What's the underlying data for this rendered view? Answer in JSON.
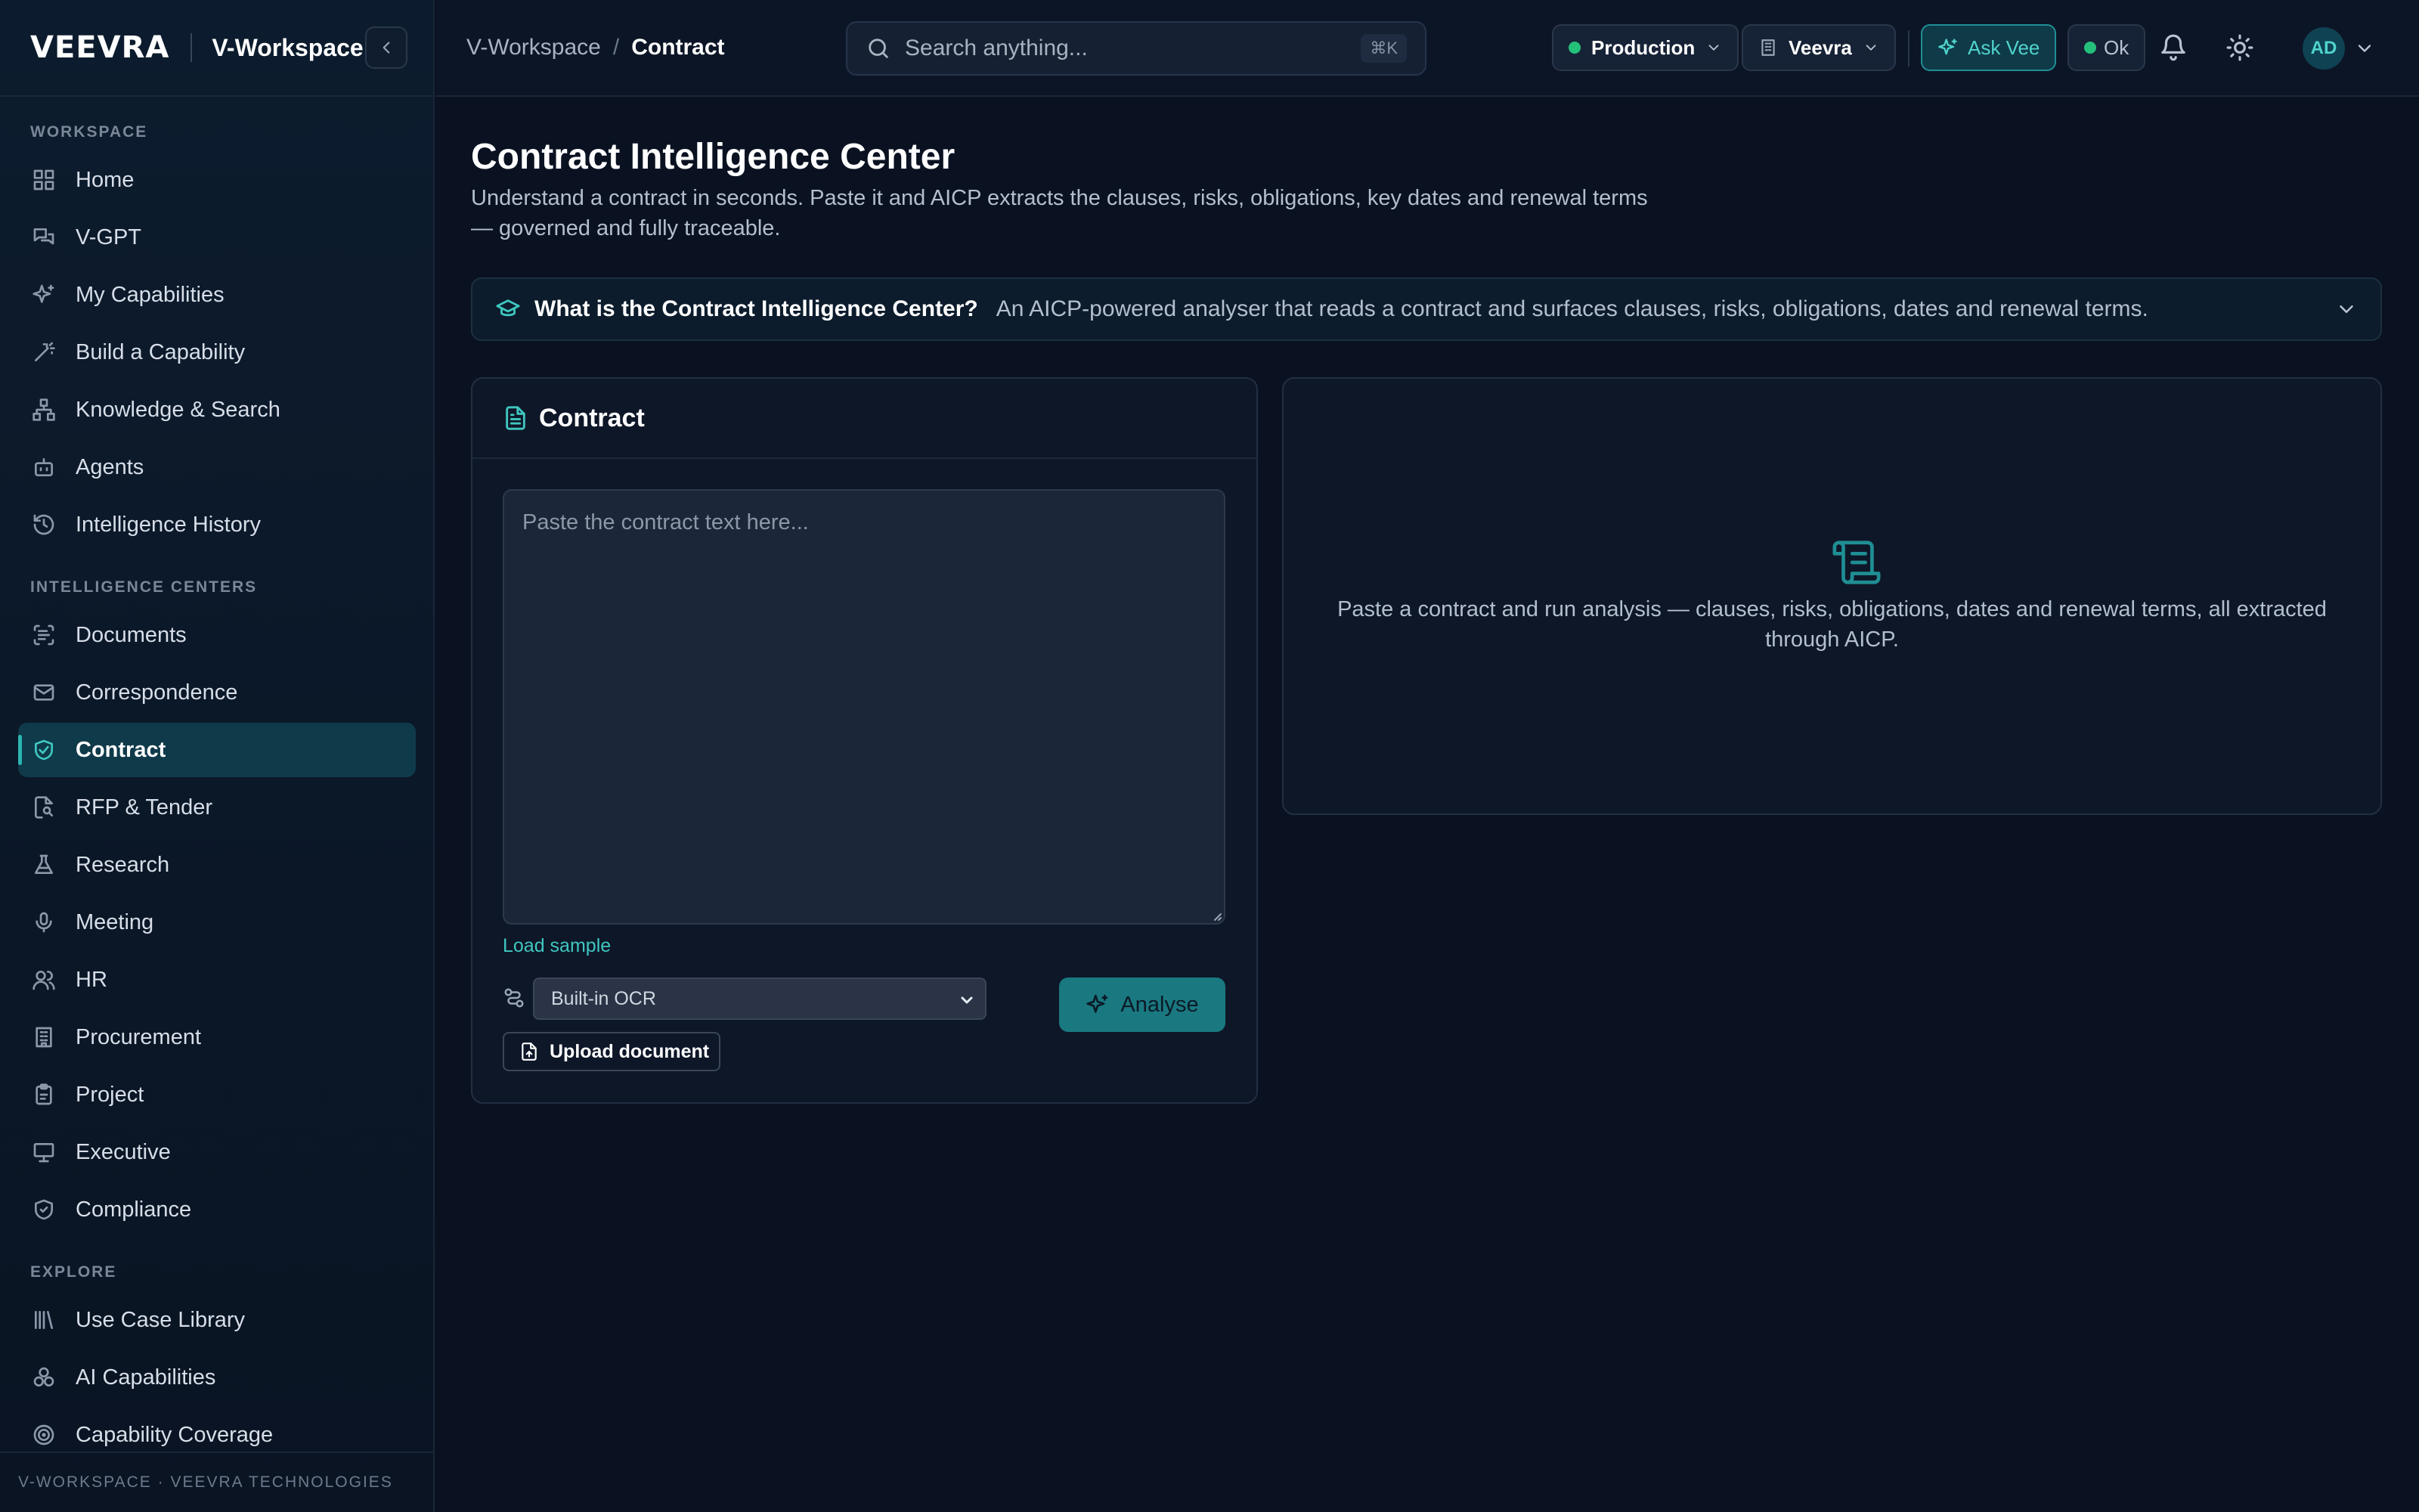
{
  "brand": {
    "logo": "VEEVRA",
    "workspace": "V-Workspace"
  },
  "sidebar": {
    "sections": [
      {
        "label": "WORKSPACE"
      },
      {
        "label": "INTELLIGENCE CENTERS"
      },
      {
        "label": "EXPLORE"
      }
    ],
    "items": [
      {
        "label": "Home",
        "icon": "grid-icon"
      },
      {
        "label": "V-GPT",
        "icon": "chat-icon"
      },
      {
        "label": "My Capabilities",
        "icon": "sparkles-icon"
      },
      {
        "label": "Build a Capability",
        "icon": "wand-icon"
      },
      {
        "label": "Knowledge & Search",
        "icon": "network-icon"
      },
      {
        "label": "Agents",
        "icon": "bot-icon"
      },
      {
        "label": "Intelligence History",
        "icon": "history-icon"
      },
      {
        "label": "Documents",
        "icon": "scan-text-icon"
      },
      {
        "label": "Correspondence",
        "icon": "mail-icon"
      },
      {
        "label": "Contract",
        "icon": "handshake-icon",
        "active": true
      },
      {
        "label": "RFP & Tender",
        "icon": "file-search-icon"
      },
      {
        "label": "Research",
        "icon": "flask-icon"
      },
      {
        "label": "Meeting",
        "icon": "mic-icon"
      },
      {
        "label": "HR",
        "icon": "users-icon"
      },
      {
        "label": "Procurement",
        "icon": "building-icon"
      },
      {
        "label": "Project",
        "icon": "clipboard-icon"
      },
      {
        "label": "Executive",
        "icon": "presentation-icon"
      },
      {
        "label": "Compliance",
        "icon": "shield-icon"
      },
      {
        "label": "Use Case Library",
        "icon": "library-icon"
      },
      {
        "label": "AI Capabilities",
        "icon": "boxes-icon"
      },
      {
        "label": "Capability Coverage",
        "icon": "target-icon"
      }
    ],
    "footer": "V-WORKSPACE · VEEVRA TECHNOLOGIES"
  },
  "topbar": {
    "breadcrumb": [
      "V-Workspace",
      "Contract"
    ],
    "breadcrumb_sep": "/",
    "search": {
      "placeholder": "Search anything...",
      "shortcut": "⌘K"
    },
    "environment": "Production",
    "org": "Veevra",
    "ask_label": "Ask Vee",
    "status": "Ok",
    "avatar": "AD",
    "colors": {
      "accent": "#3fc7c0",
      "status_ok": "#24c07a"
    }
  },
  "main": {
    "title": "Contract Intelligence Center",
    "subtitle": "Understand a contract in seconds. Paste it and AICP extracts the clauses, risks, obligations, key dates and renewal terms — governed and fully traceable.",
    "info": {
      "question": "What is the Contract Intelligence Center?",
      "answer": "An AICP-powered analyser that reads a contract and surfaces clauses, risks, obligations, dates and renewal terms."
    },
    "input_card": {
      "title": "Contract",
      "placeholder": "Paste the contract text here...",
      "load_sample": "Load sample",
      "ocr_selected": "Built-in OCR",
      "analyse_label": "Analyse",
      "upload_label": "Upload document"
    },
    "result_card": {
      "empty_text": "Paste a contract and run analysis — clauses, risks, obligations, dates and renewal terms, all extracted through AICP."
    }
  }
}
